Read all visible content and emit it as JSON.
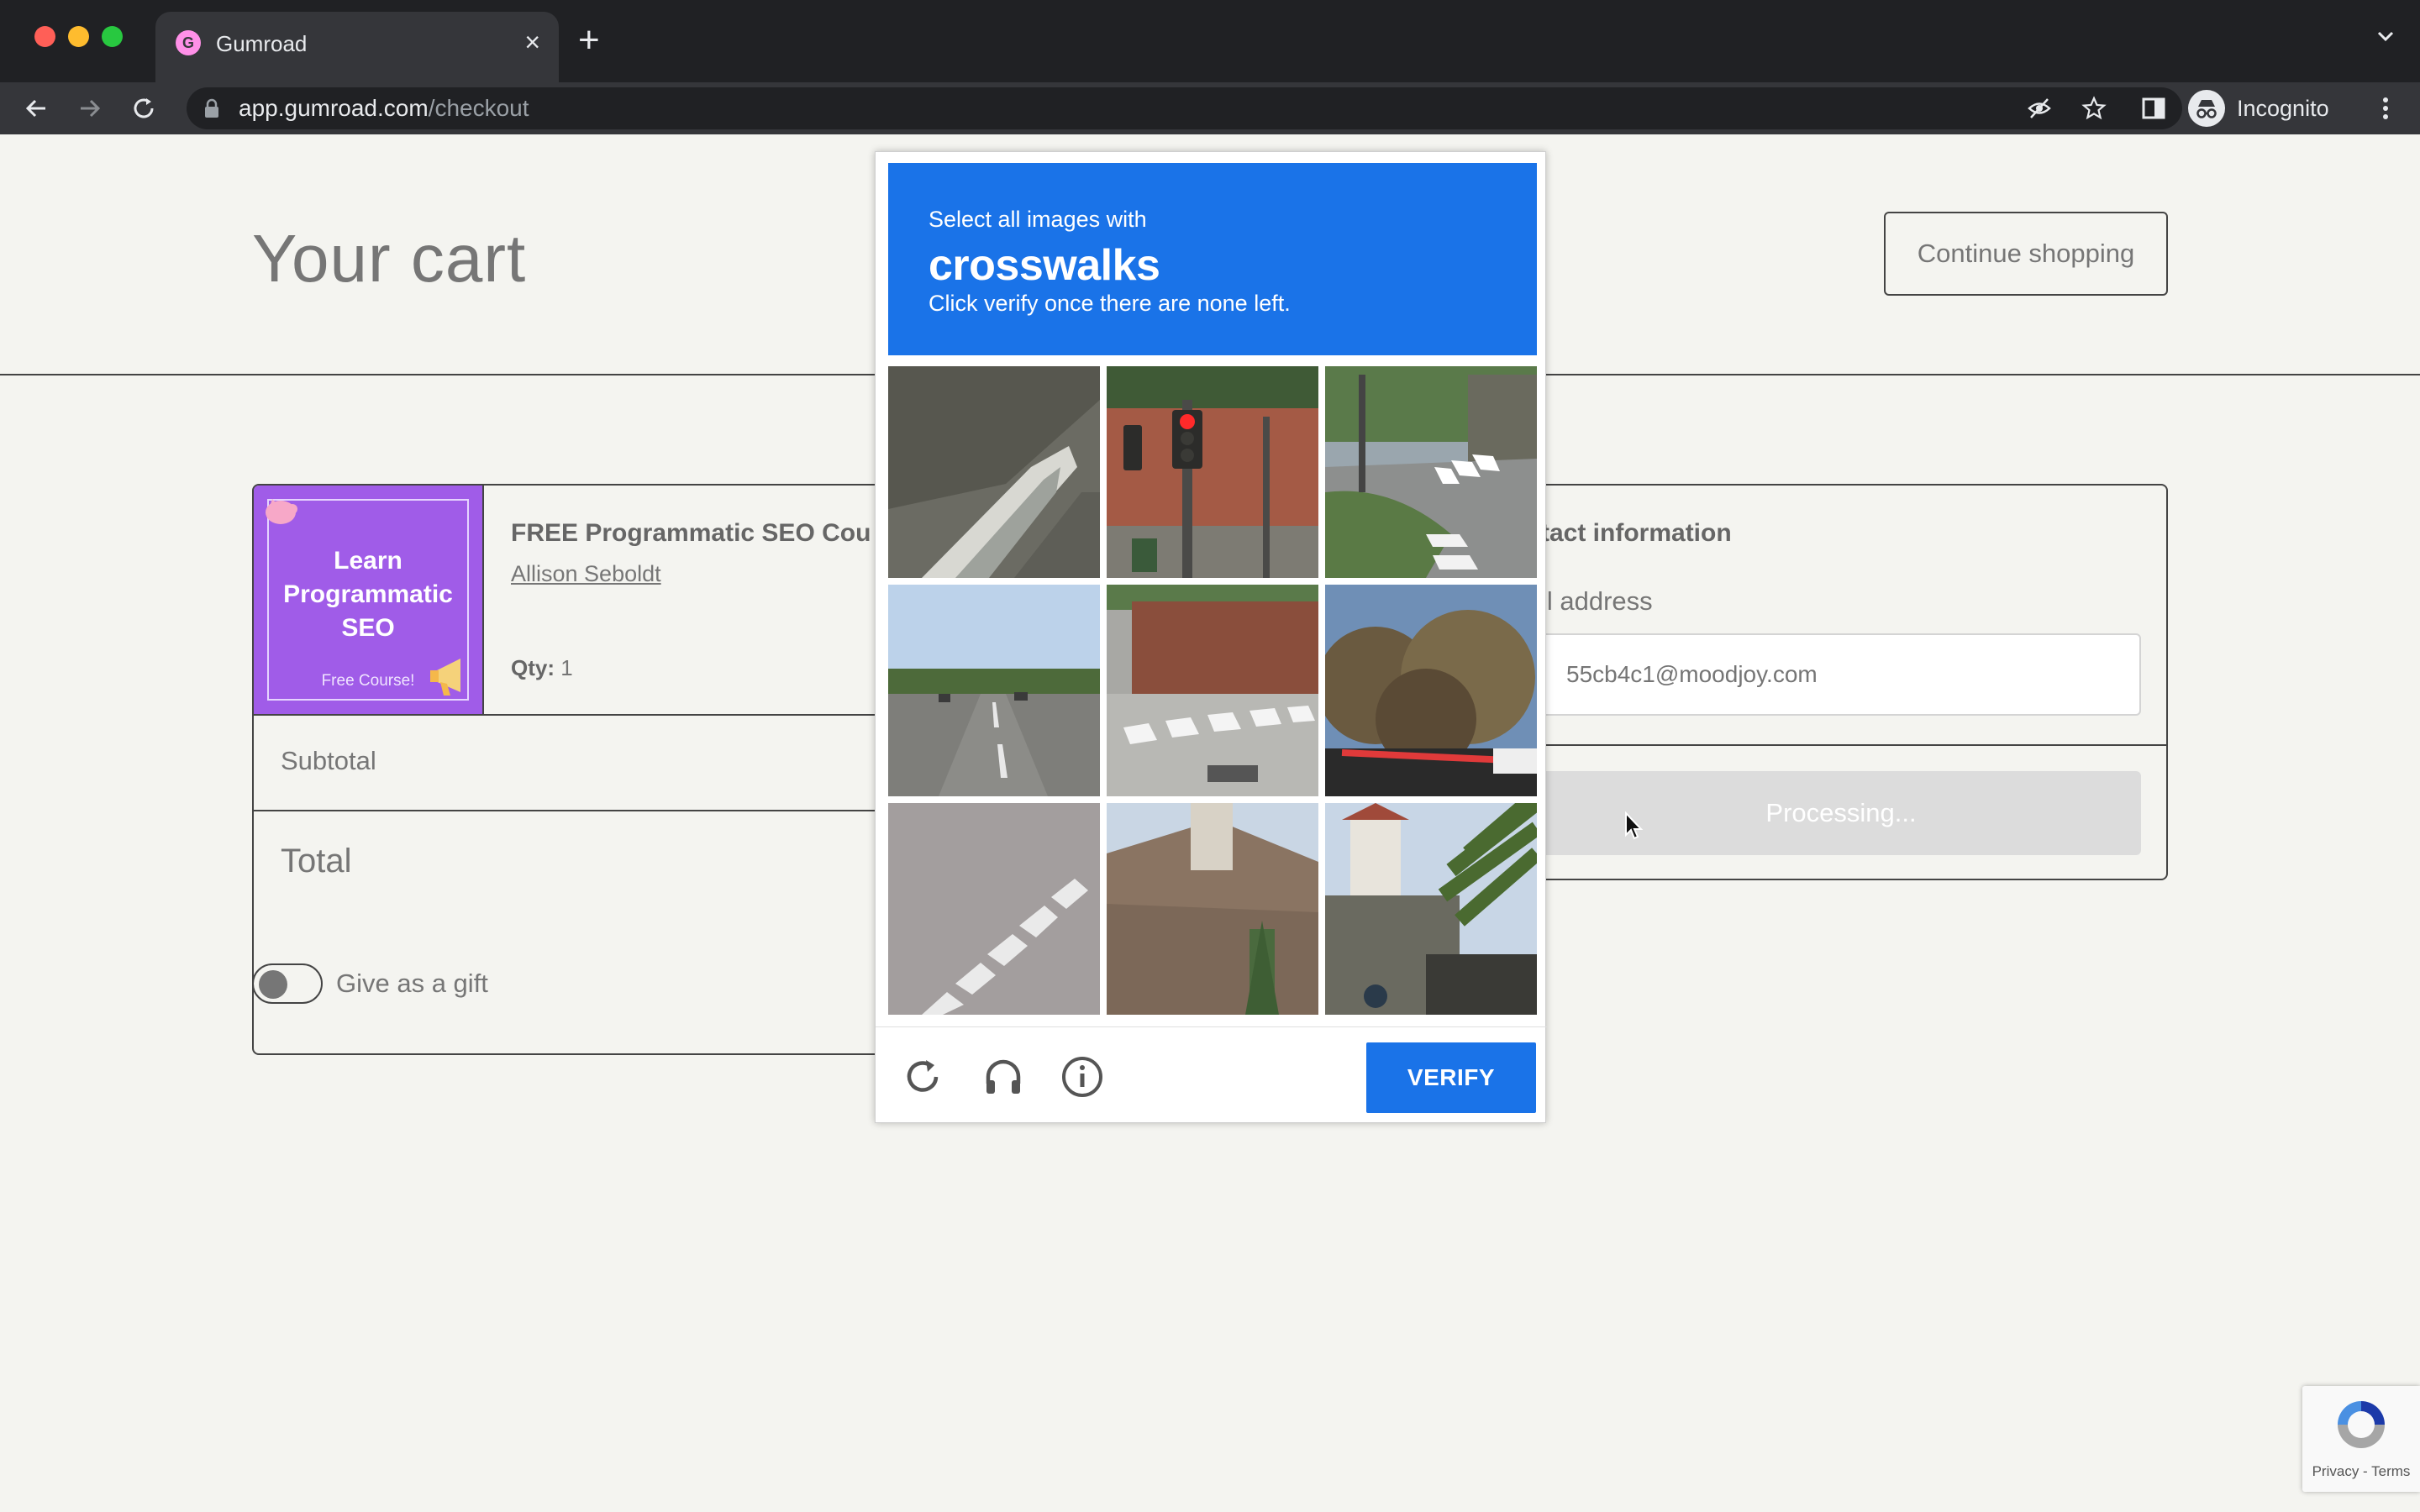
{
  "browser": {
    "tab_title": "Gumroad",
    "tab_favicon_letter": "G",
    "url_host": "app.gumroad.com",
    "url_path": "/checkout",
    "profile_label": "Incognito"
  },
  "page": {
    "title": "Your cart",
    "continue_label": "Continue shopping"
  },
  "cart": {
    "item": {
      "thumb_title": "Learn Programmatic SEO",
      "thumb_subtitle": "Free Course!",
      "title": "FREE Programmatic SEO Cou",
      "author": "Allison Seboldt",
      "qty_label": "Qty:",
      "qty_value": "1"
    },
    "subtotal_label": "Subtotal",
    "total_label": "Total",
    "gift_label": "Give as a gift",
    "gift_enabled": false
  },
  "contact": {
    "title": "tact information",
    "email_label": "il address",
    "email_placeholder": "55cb4c1@moodjoy.com",
    "submit_label": "Processing..."
  },
  "captcha": {
    "instruction_line1": "Select all images with",
    "keyword": "crosswalks",
    "instruction_line3": "Click verify once there are none left.",
    "verify_label": "VERIFY",
    "tiles": [
      "road-barrier",
      "traffic-light",
      "street-corner-crosswalk",
      "highway",
      "crosswalk-wall",
      "trees-sign",
      "crosswalk-pavement",
      "house-roof",
      "palm-house"
    ]
  },
  "badge": {
    "text": "Privacy - Terms"
  },
  "colors": {
    "captcha_blue": "#1a73e8",
    "thumb_purple": "#a05ce8",
    "page_bg": "#f4f4f0"
  }
}
